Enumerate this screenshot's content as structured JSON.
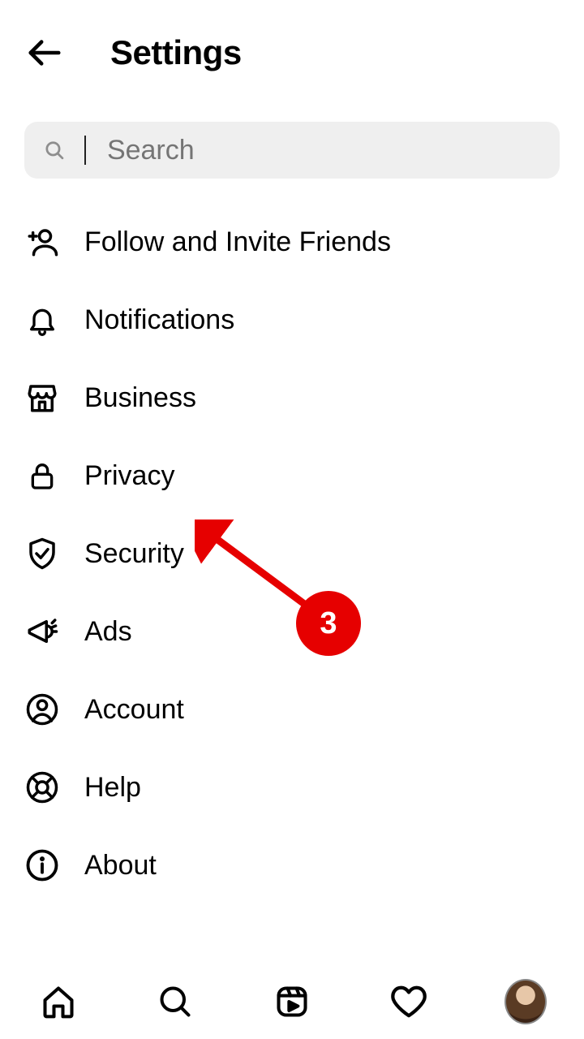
{
  "header": {
    "title": "Settings"
  },
  "search": {
    "placeholder": "Search"
  },
  "menu": {
    "items": [
      {
        "label": "Follow and Invite Friends",
        "icon": "add-user-icon"
      },
      {
        "label": "Notifications",
        "icon": "bell-icon"
      },
      {
        "label": "Business",
        "icon": "storefront-icon"
      },
      {
        "label": "Privacy",
        "icon": "lock-icon"
      },
      {
        "label": "Security",
        "icon": "shield-check-icon"
      },
      {
        "label": "Ads",
        "icon": "megaphone-icon"
      },
      {
        "label": "Account",
        "icon": "user-circle-icon"
      },
      {
        "label": "Help",
        "icon": "life-ring-icon"
      },
      {
        "label": "About",
        "icon": "info-circle-icon"
      }
    ]
  },
  "annotation": {
    "step_number": "3",
    "target_item_index": 3
  },
  "bottom_nav": {
    "items": [
      {
        "name": "home-icon"
      },
      {
        "name": "search-icon"
      },
      {
        "name": "reels-icon"
      },
      {
        "name": "heart-icon"
      },
      {
        "name": "profile-avatar"
      }
    ]
  }
}
